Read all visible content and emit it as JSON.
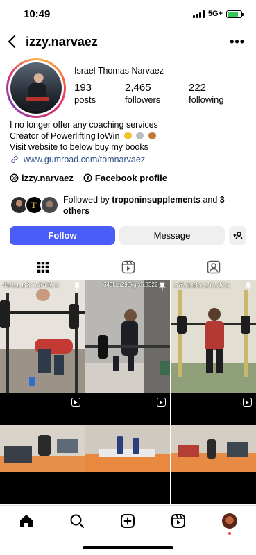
{
  "status": {
    "time": "10:49",
    "network": "5G+"
  },
  "profile": {
    "username": "izzy.narvaez",
    "display_name": "Israel Thomas Narvaez",
    "stats": [
      {
        "value": "193",
        "label": "posts"
      },
      {
        "value": "2,465",
        "label": "followers"
      },
      {
        "value": "222",
        "label": "following"
      }
    ],
    "bio": [
      "I no longer offer any coaching services",
      "Creator of PowerliftingToWin",
      "Visit website to below buy my books"
    ],
    "website": "www.gumroad.com/tomnarvaez",
    "threads_handle": "izzy.narvaez",
    "facebook_label": "Facebook profile",
    "followed_by": {
      "prefix": "Followed by ",
      "name": "troponinsupplements",
      "mid": " and ",
      "others": "3 others"
    }
  },
  "actions": {
    "follow": "Follow",
    "message": "Message"
  },
  "grid": {
    "captions": [
      "405LBS/184KG",
      "645lbs/293kg x5.3322",
      "585LBS/265KG"
    ]
  },
  "colors": {
    "accent": "#4a5df9",
    "link": "#2a4f86",
    "battery": "#34c759"
  }
}
